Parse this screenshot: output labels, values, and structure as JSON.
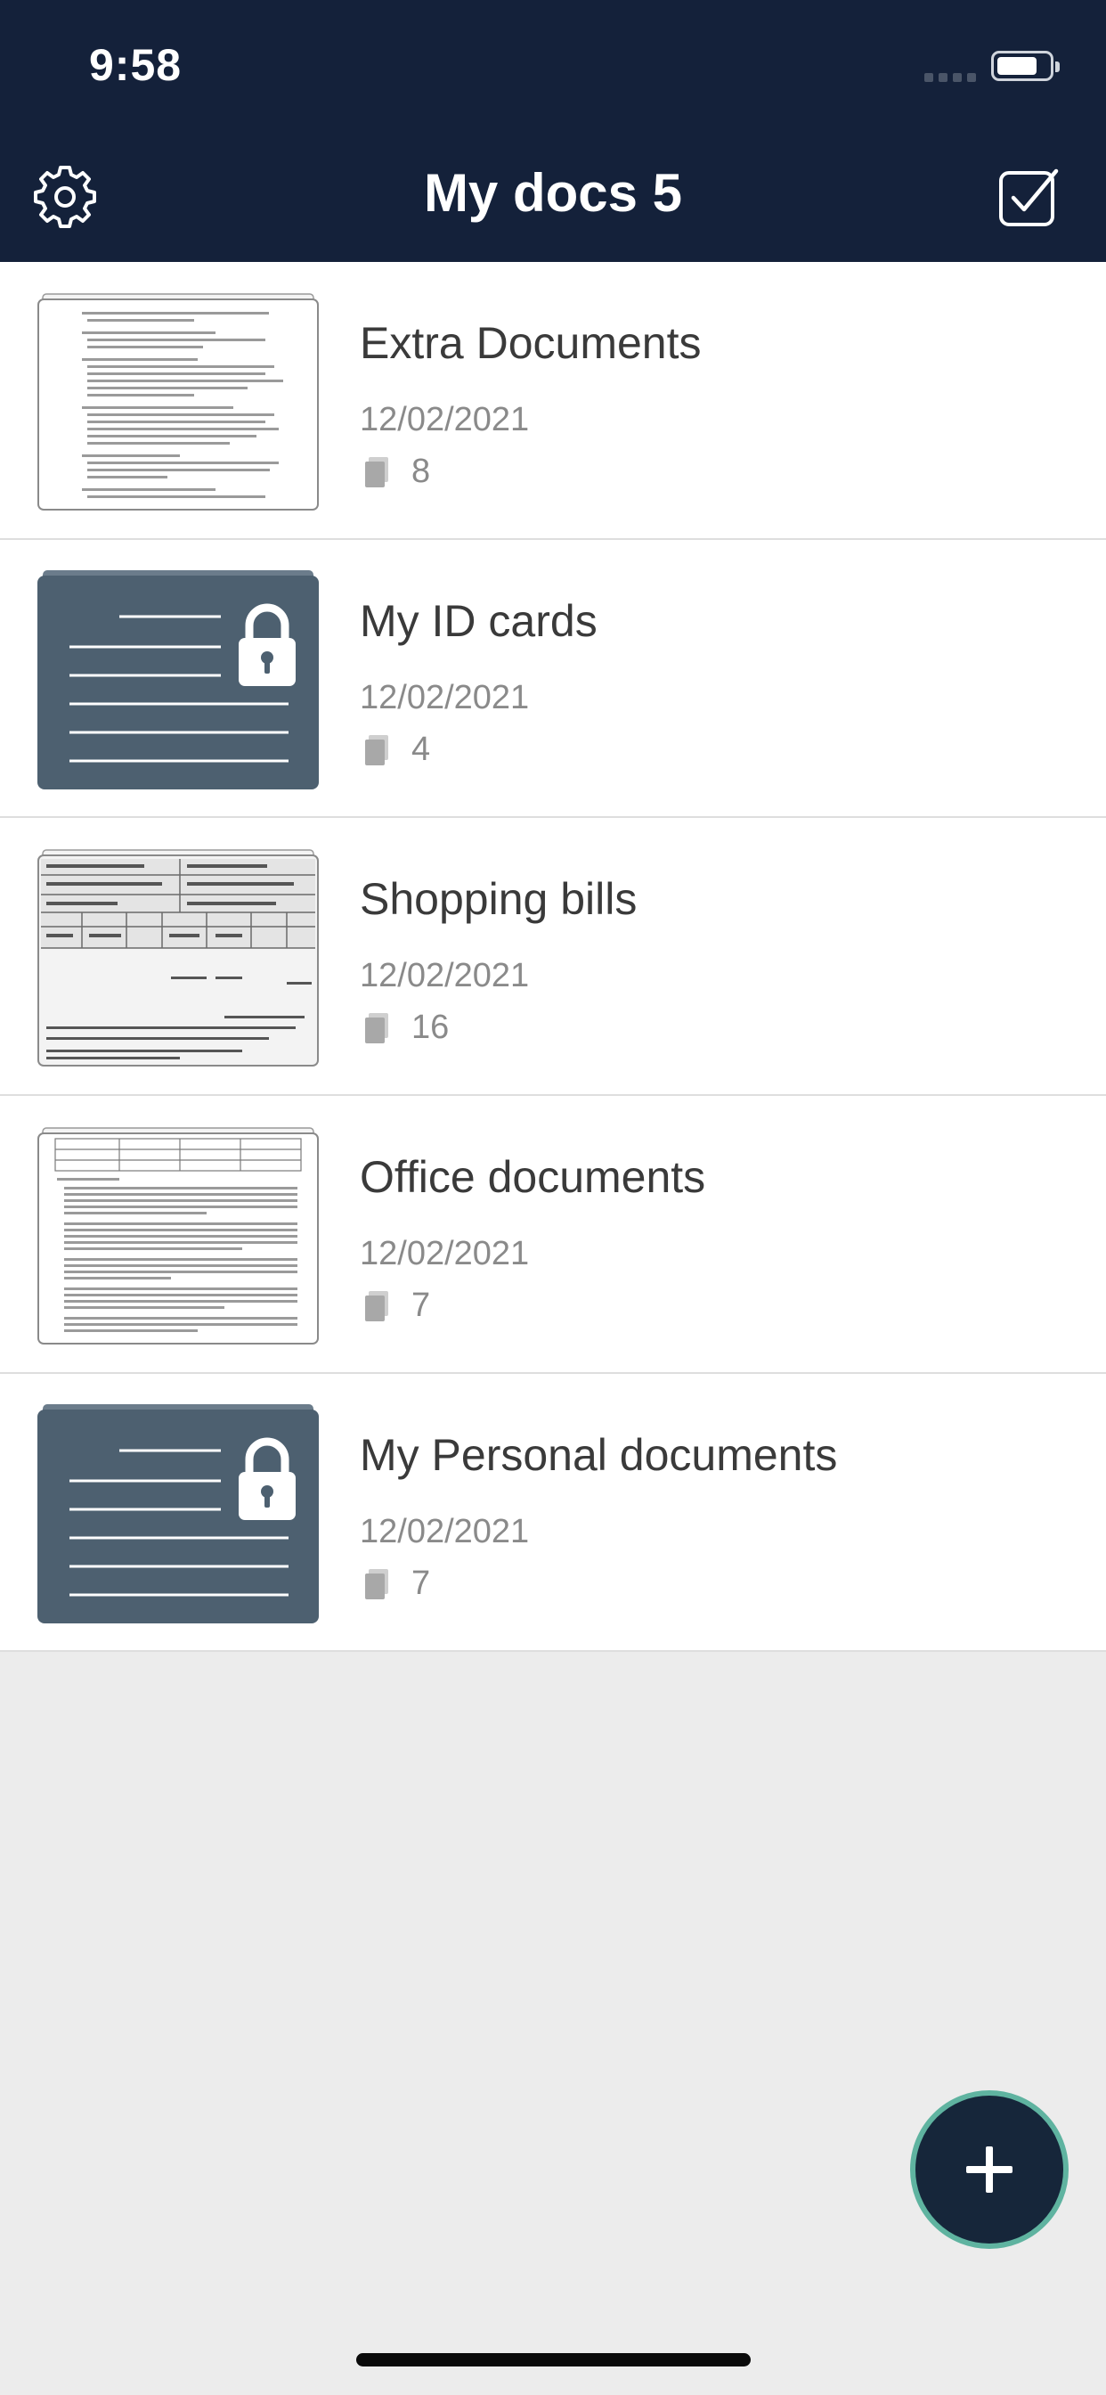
{
  "status_bar": {
    "time": "9:58"
  },
  "header": {
    "title": "My docs 5",
    "settings_icon": "gear-icon",
    "select_icon": "checkbox-checked-icon"
  },
  "documents": [
    {
      "title": "Extra Documents",
      "date": "12/02/2021",
      "count": "8",
      "thumbnail": "text-page",
      "locked": false
    },
    {
      "title": "My ID cards",
      "date": "12/02/2021",
      "count": "4",
      "thumbnail": "locked-folder",
      "locked": true
    },
    {
      "title": "Shopping bills",
      "date": "12/02/2021",
      "count": "16",
      "thumbnail": "invoice-page",
      "locked": false
    },
    {
      "title": "Office documents",
      "date": "12/02/2021",
      "count": "7",
      "thumbnail": "report-page",
      "locked": false
    },
    {
      "title": "My Personal documents",
      "date": "12/02/2021",
      "count": "7",
      "thumbnail": "locked-folder",
      "locked": true
    }
  ],
  "fab": {
    "icon": "plus-icon"
  },
  "colors": {
    "header_bg": "#14213a",
    "locked_thumb_bg": "#4d6070",
    "fab_bg": "#16263a",
    "fab_ring": "#5fb3a0",
    "list_bg": "#ececec"
  }
}
